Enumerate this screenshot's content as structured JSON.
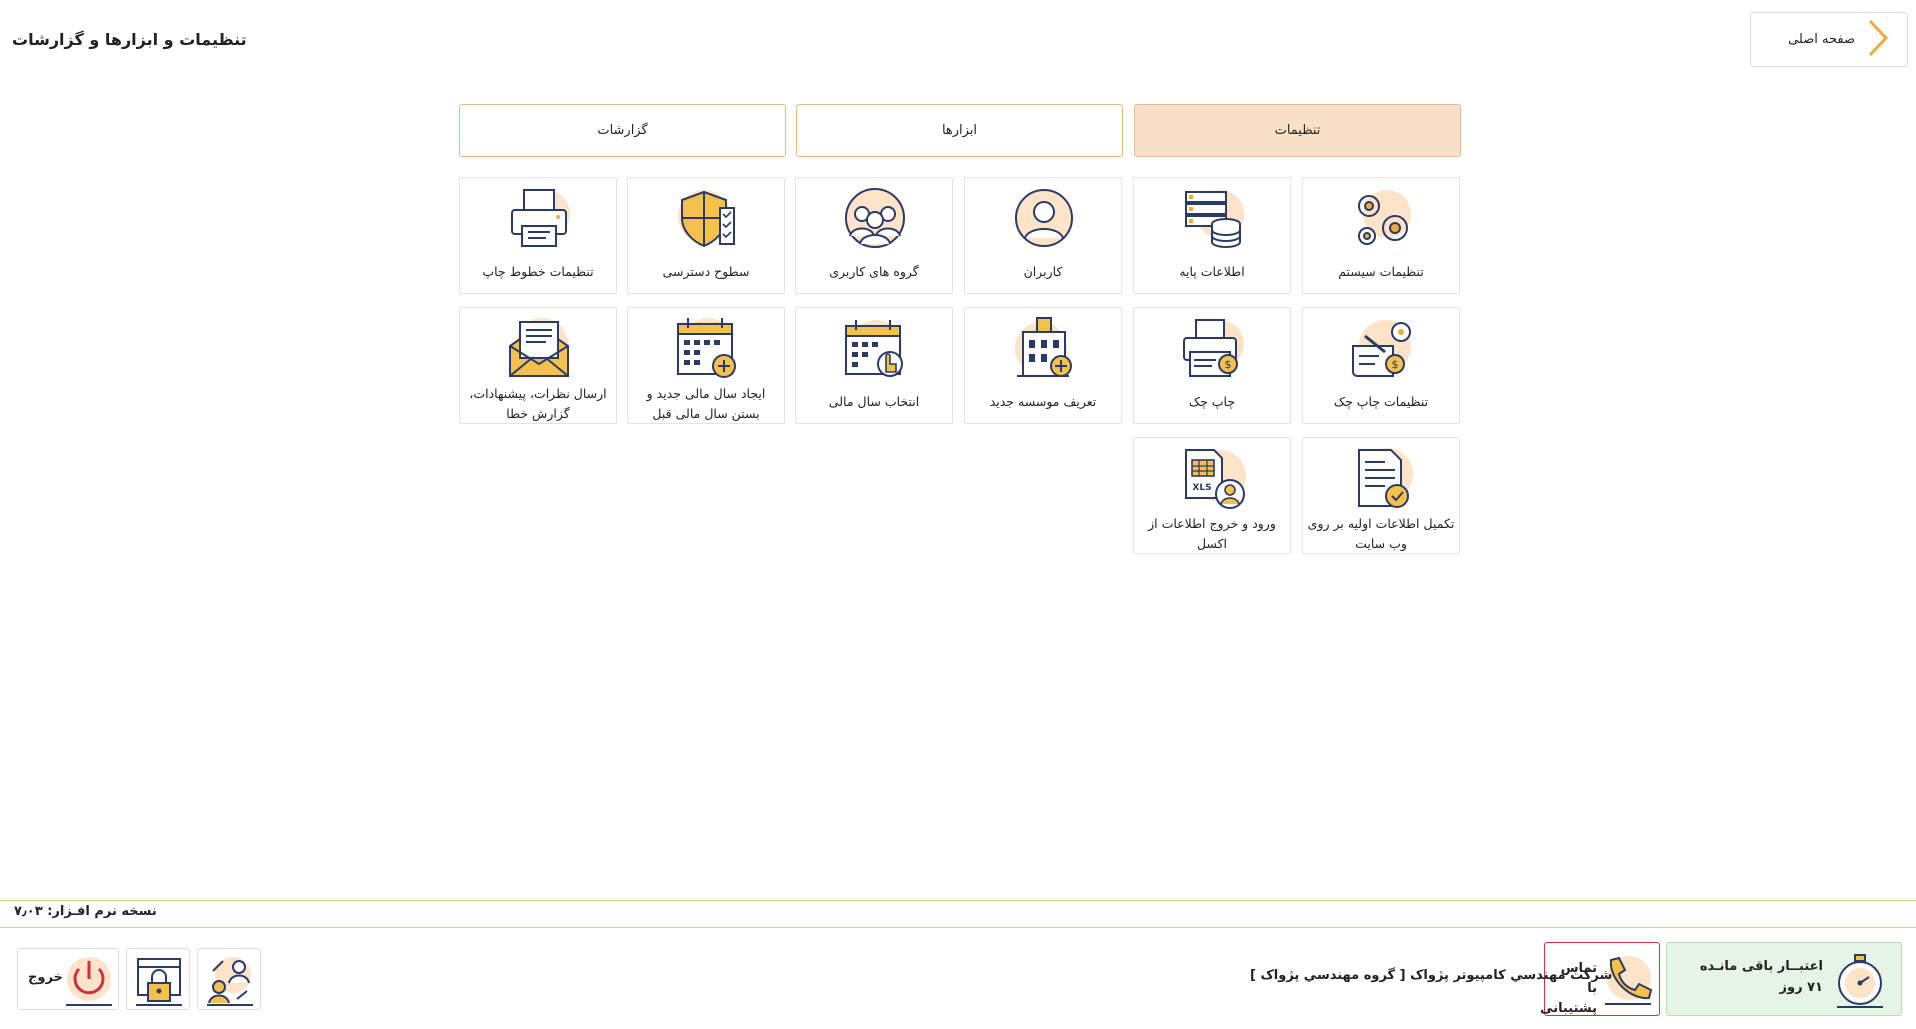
{
  "header": {
    "home_label": "صفحه اصلی",
    "page_title": "تنظیمات و ابزارها و گزارشات"
  },
  "tabs": [
    {
      "label": "تنظیمات",
      "active": true
    },
    {
      "label": "ابزارها",
      "active": false
    },
    {
      "label": "گزارشات",
      "active": false
    }
  ],
  "tiles": [
    {
      "label": "تنظیمات سیستم",
      "icon": "gears-icon"
    },
    {
      "label": "اطلاعات پایه",
      "icon": "database-icon"
    },
    {
      "label": "کاربران",
      "icon": "user-icon"
    },
    {
      "label": "گروه های کاربری",
      "icon": "user-group-icon"
    },
    {
      "label": "سطوح دسترسی",
      "icon": "shield-checklist-icon"
    },
    {
      "label": "تنظیمات خطوط چاپ",
      "icon": "printer-icon"
    },
    {
      "label": "تنظیمات چاپ چک",
      "icon": "cheque-settings-icon"
    },
    {
      "label": "چاپ چک",
      "icon": "cheque-print-icon"
    },
    {
      "label": "تعریف موسسه جدید",
      "icon": "building-add-icon"
    },
    {
      "label": "انتخاب سال مالی",
      "icon": "calendar-select-icon"
    },
    {
      "label": "ایجاد سال مالی جدید و بستن سال مالی قبل",
      "icon": "calendar-add-icon"
    },
    {
      "label": "ارسال نظرات، پیشنهادات، گزارش خطا",
      "icon": "mail-icon"
    },
    {
      "label": "تکمیل اطلاعات اولیه بر روی وب سایت",
      "icon": "document-check-icon"
    },
    {
      "label": "ورود و خروج اطلاعات از اکسل",
      "icon": "excel-user-icon"
    }
  ],
  "footer": {
    "version": "نسخه نرم افـزار: ۷٫۰۳",
    "credit_line1": "اعتبــار باقی مانـده",
    "credit_line2": "۷۱ روز",
    "support_label": "تماس با پشتیبانی",
    "company": "شرکت مهندسي کامپيوتر پژواک [ گروه مهندسي پژواک ]",
    "exit_label": "خروج"
  },
  "colors": {
    "accent_orange": "#f0a93c",
    "tab_active_bg": "#fbe0c8",
    "icon_navy": "#2b3a67",
    "icon_circle": "#fde3c8",
    "credit_green_bg": "#e6f4e6",
    "support_red": "#d03040"
  }
}
